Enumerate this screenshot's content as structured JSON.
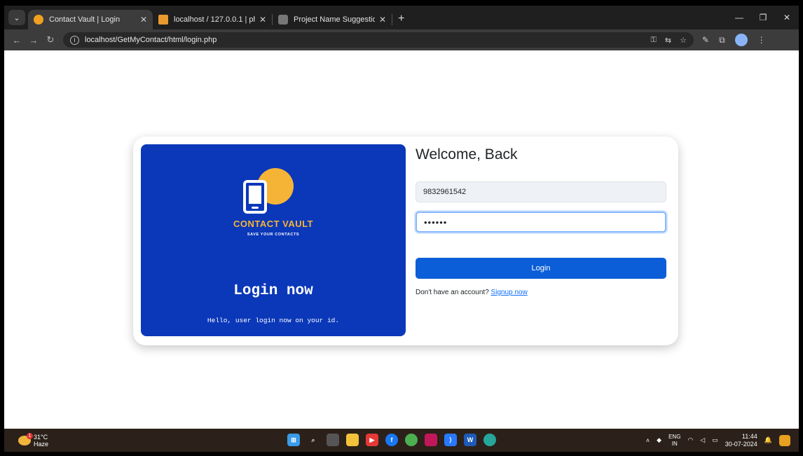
{
  "browser": {
    "tabs": [
      {
        "title": "Contact Vault | Login",
        "active": true
      },
      {
        "title": "localhost / 127.0.0.1 | phpMyAd",
        "active": false
      },
      {
        "title": "Project Name Suggestion",
        "active": false
      }
    ],
    "url": "localhost/GetMyContact/html/login.php"
  },
  "brand": {
    "name": "CONTACT VAULT",
    "tagline": "SAVE YOUR CONTACTS",
    "heading": "Login now",
    "message": "Hello, user login now on your id."
  },
  "form": {
    "title": "Welcome, Back",
    "phone_value": "9832961542",
    "password_value": "••••••",
    "login_label": "Login",
    "signup_prompt": "Don't have an account?",
    "signup_link": "Signup now"
  },
  "taskbar": {
    "temperature": "31°C",
    "weather": "Haze",
    "lang_top": "ENG",
    "lang_bottom": "IN",
    "time": "11:44",
    "date": "30-07-2024"
  },
  "colors": {
    "brand_panel": "#0b38b9",
    "accent": "#f6b437",
    "button": "#0b5ed7"
  }
}
